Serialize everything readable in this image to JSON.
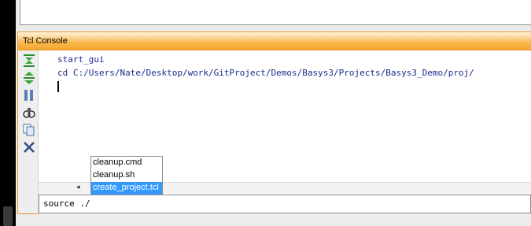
{
  "console": {
    "title": "Tcl Console",
    "lines": [
      "start_gui",
      "cd C:/Users/Nate/Desktop/work/GitProject/Demos/Basys3/Projects/Basys3_Demo/proj/"
    ],
    "command_input": "source ./",
    "toolbar": [
      {
        "icon": "collapse-all-icon"
      },
      {
        "icon": "expand-all-icon"
      },
      {
        "icon": "pause-icon"
      },
      {
        "icon": "find-icon"
      },
      {
        "icon": "copy-icon"
      },
      {
        "icon": "clear-icon"
      }
    ]
  },
  "autocomplete": {
    "options": [
      "cleanup.cmd",
      "cleanup.sh",
      "create_project.tcl"
    ],
    "selected_index": 2
  },
  "colors": {
    "header_orange": "#f5a832",
    "selection": "#3399ff",
    "console_text": "#1b2b8c"
  }
}
